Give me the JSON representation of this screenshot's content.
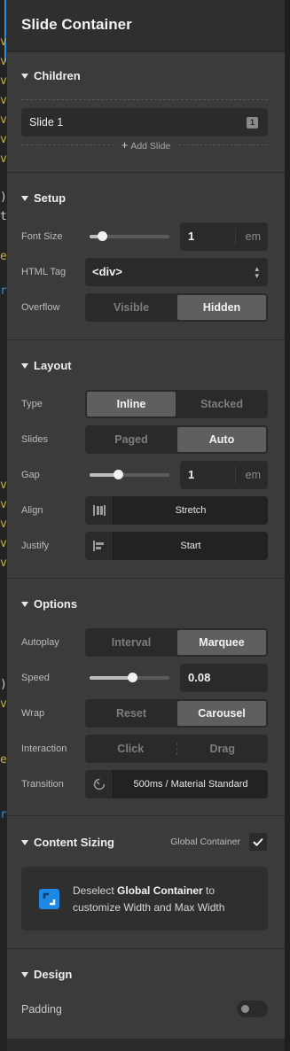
{
  "panel": {
    "title": "Slide Container"
  },
  "children": {
    "title": "Children",
    "slides": [
      {
        "label": "Slide 1",
        "badge": "1"
      }
    ],
    "add_label": "Add Slide"
  },
  "setup": {
    "title": "Setup",
    "font_size": {
      "label": "Font Size",
      "value": "1",
      "unit": "em",
      "slider_fraction": 0.15
    },
    "html_tag": {
      "label": "HTML Tag",
      "value": "<div>"
    },
    "overflow": {
      "label": "Overflow",
      "options": [
        "Visible",
        "Hidden"
      ],
      "selected": "Hidden"
    }
  },
  "layout": {
    "title": "Layout",
    "type": {
      "label": "Type",
      "options": [
        "Inline",
        "Stacked"
      ],
      "selected": "Inline"
    },
    "slides": {
      "label": "Slides",
      "options": [
        "Paged",
        "Auto"
      ],
      "selected": "Auto"
    },
    "gap": {
      "label": "Gap",
      "value": "1",
      "unit": "em",
      "slider_fraction": 0.36
    },
    "align": {
      "label": "Align",
      "value": "Stretch",
      "icon": "align-stretch-icon"
    },
    "justify": {
      "label": "Justify",
      "value": "Start",
      "icon": "justify-start-icon"
    }
  },
  "options": {
    "title": "Options",
    "autoplay": {
      "label": "Autoplay",
      "options": [
        "Interval",
        "Marquee"
      ],
      "selected": "Marquee"
    },
    "speed": {
      "label": "Speed",
      "value": "0.08",
      "slider_fraction": 0.53
    },
    "wrap": {
      "label": "Wrap",
      "options": [
        "Reset",
        "Carousel"
      ],
      "selected": "Carousel"
    },
    "interaction": {
      "label": "Interaction",
      "options": [
        "Click",
        "Drag"
      ],
      "selected": ""
    },
    "transition": {
      "label": "Transition",
      "value": "500ms / Material Standard",
      "icon": "timer-icon"
    }
  },
  "content_sizing": {
    "title": "Content Sizing",
    "global_label": "Global Container",
    "global_checked": true,
    "notice_prefix": "Deselect ",
    "notice_bold": "Global Container",
    "notice_suffix": " to customize Width and Max Width"
  },
  "design": {
    "title": "Design",
    "padding_label": "Padding",
    "padding_enabled": false
  },
  "colors": {
    "panel_bg": "#3b3b3b",
    "control_bg": "#2a2a2a",
    "selected_bg": "#5f5f5f",
    "accent_blue": "#1e88e5"
  }
}
